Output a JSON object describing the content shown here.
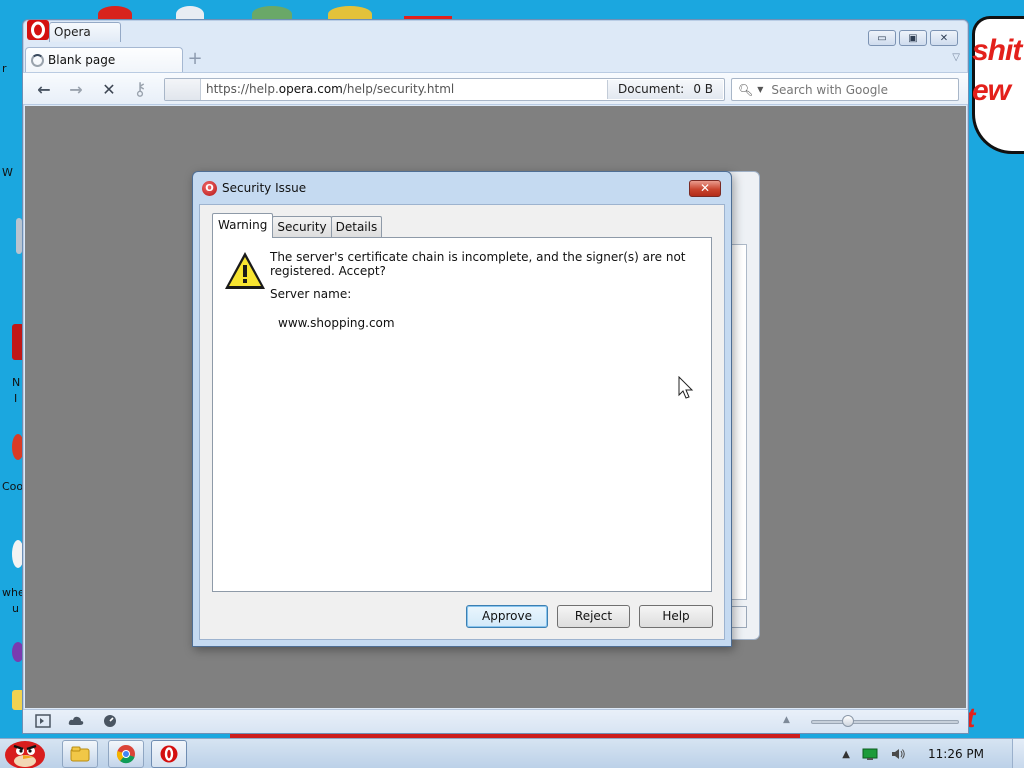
{
  "desktop": {
    "cartoon_line1": "shit",
    "cartoon_line2": "ew",
    "cartoon_bottom": "t",
    "left_fragments": [
      "r",
      "W",
      "N",
      "I",
      "Coo",
      "whe",
      "u"
    ]
  },
  "browser": {
    "app_tab_label": "Opera",
    "tab_label": "Blank page",
    "new_tab_symbol": "+",
    "tab_menu_symbol": "▽",
    "window_controls": {
      "minimize": "▭",
      "maximize": "▣",
      "close": "✕"
    },
    "nav": {
      "back": "←",
      "forward": "→",
      "stop": "✕",
      "key": "⚷"
    },
    "address": {
      "prefix": "https://help.",
      "domain": "opera.com",
      "suffix": "/help/security.html",
      "doc_label": "Document:",
      "doc_size": "0 B"
    },
    "search": {
      "placeholder": "Search with Google",
      "icon": "search-icon"
    },
    "status_icons": [
      "panel-toggle-icon",
      "cloud-icon",
      "speed-dial-icon"
    ],
    "zoom_level": 0.25
  },
  "dialog": {
    "title": "Security Issue",
    "close_symbol": "✕",
    "tabs": [
      {
        "label": "Warning",
        "active": true
      },
      {
        "label": "Security",
        "active": false
      },
      {
        "label": "Details",
        "active": false
      }
    ],
    "message": "The server's certificate chain is incomplete, and the signer(s) are not registered. Accept?",
    "server_label": "Server name:",
    "server_value": "www.shopping.com",
    "buttons": {
      "approve": "Approve",
      "reject": "Reject",
      "help": "Help"
    }
  },
  "taskbar": {
    "clock": "11:26 PM",
    "tray_expand": "▲",
    "items": [
      "explorer-icon",
      "chrome-icon",
      "opera-icon"
    ]
  }
}
